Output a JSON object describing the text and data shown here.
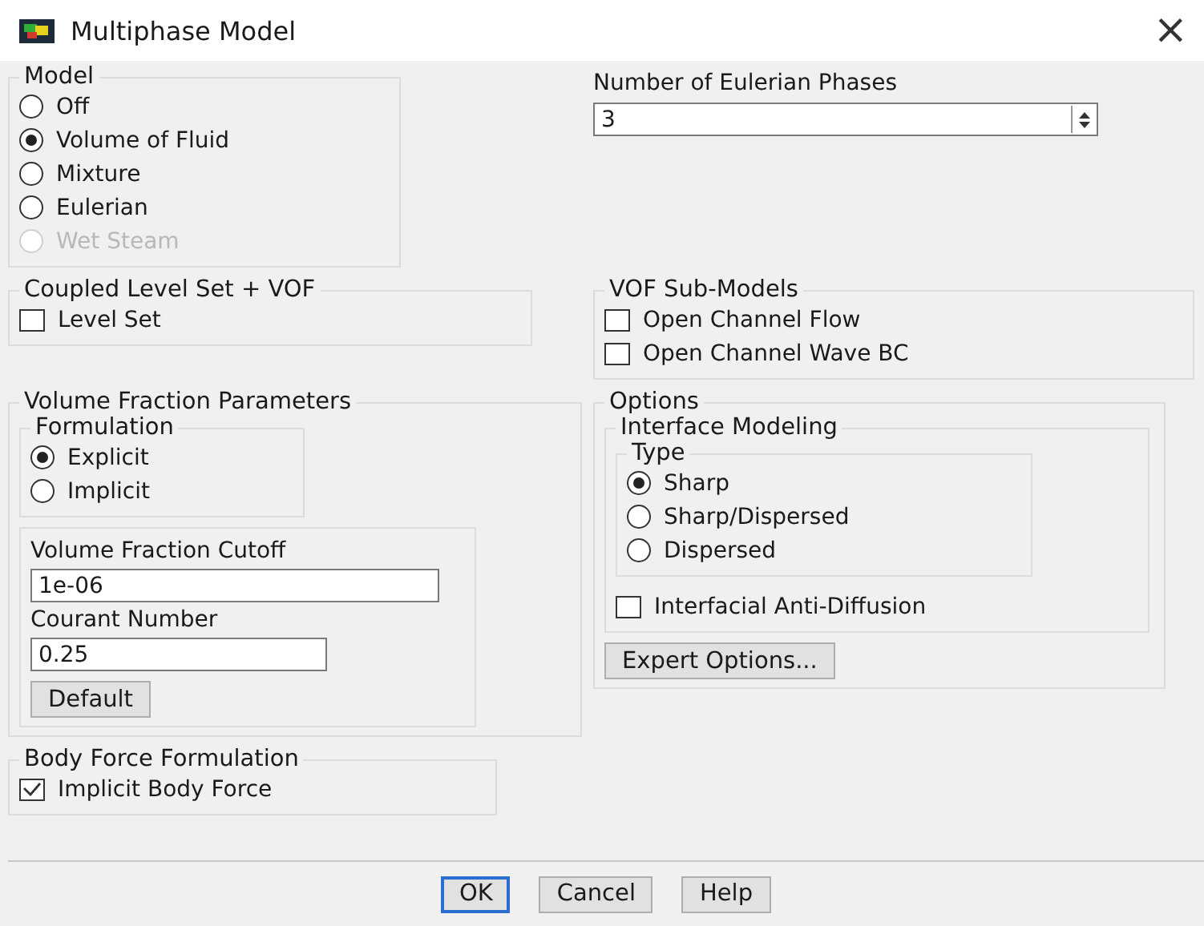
{
  "window": {
    "title": "Multiphase Model",
    "close": "×"
  },
  "model": {
    "legend": "Model",
    "options": [
      {
        "label": "Off",
        "selected": false,
        "disabled": false
      },
      {
        "label": "Volume of Fluid",
        "selected": true,
        "disabled": false
      },
      {
        "label": "Mixture",
        "selected": false,
        "disabled": false
      },
      {
        "label": "Eulerian",
        "selected": false,
        "disabled": false
      },
      {
        "label": "Wet Steam",
        "selected": false,
        "disabled": true
      }
    ]
  },
  "phases": {
    "label": "Number of Eulerian Phases",
    "value": "3"
  },
  "coupled_level_set": {
    "legend": "Coupled Level Set + VOF",
    "checkboxes": [
      {
        "label": "Level Set",
        "checked": false
      }
    ]
  },
  "vof_sub_models": {
    "legend": "VOF Sub-Models",
    "checkboxes": [
      {
        "label": "Open Channel Flow",
        "checked": false
      },
      {
        "label": "Open Channel Wave BC",
        "checked": false
      }
    ]
  },
  "volume_fraction_parameters": {
    "legend": "Volume Fraction Parameters",
    "formulation": {
      "legend": "Formulation",
      "options": [
        {
          "label": "Explicit",
          "selected": true
        },
        {
          "label": "Implicit",
          "selected": false
        }
      ]
    },
    "fields": [
      {
        "label": "Volume Fraction Cutoff",
        "value": "1e-06",
        "wide": true
      },
      {
        "label": "Courant Number",
        "value": "0.25",
        "wide": false
      }
    ],
    "default_button": "Default"
  },
  "options": {
    "legend": "Options",
    "interface_modeling": {
      "legend": "Interface Modeling",
      "type": {
        "legend": "Type",
        "options": [
          {
            "label": "Sharp",
            "selected": true
          },
          {
            "label": "Sharp/Dispersed",
            "selected": false
          },
          {
            "label": "Dispersed",
            "selected": false
          }
        ]
      },
      "checkboxes": [
        {
          "label": "Interfacial Anti-Diffusion",
          "checked": false
        }
      ]
    },
    "expert_button": "Expert Options..."
  },
  "body_force": {
    "legend": "Body Force Formulation",
    "checkboxes": [
      {
        "label": "Implicit Body Force",
        "checked": true
      }
    ]
  },
  "buttons": [
    {
      "label": "OK",
      "focused": true
    },
    {
      "label": "Cancel",
      "focused": false
    },
    {
      "label": "Help",
      "focused": false
    }
  ]
}
